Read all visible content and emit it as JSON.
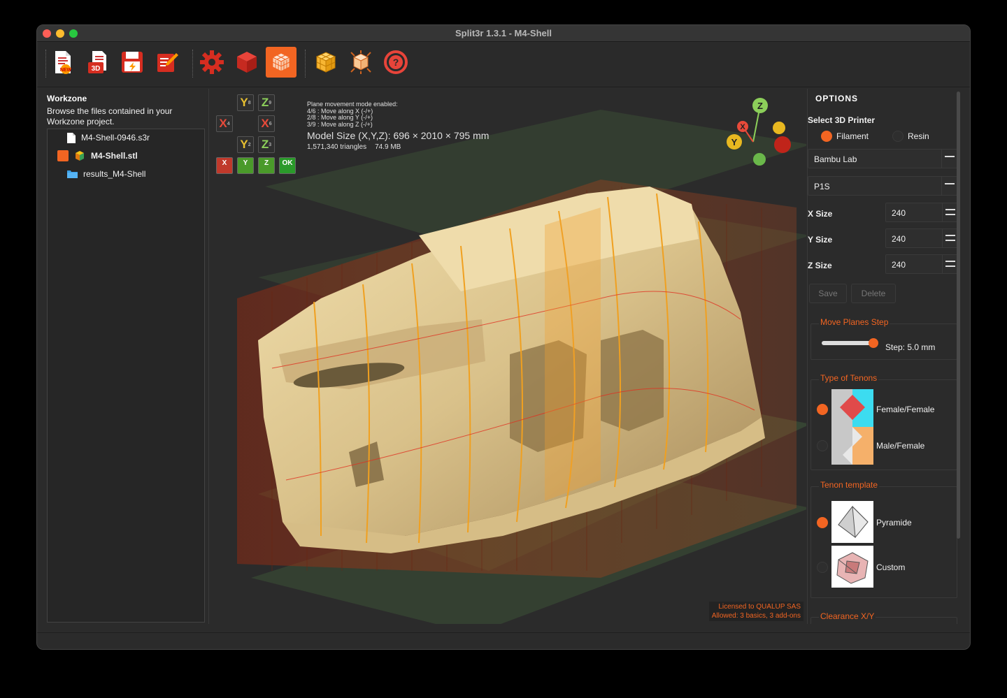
{
  "window": {
    "title": "Split3r 1.3.1 - M4-Shell"
  },
  "toolbar": {
    "buttons": [
      {
        "name": "new-project",
        "icon": "new-file-icon"
      },
      {
        "name": "open-3d",
        "icon": "open-3d-icon",
        "badge": "3D"
      },
      {
        "name": "save",
        "icon": "save-icon"
      },
      {
        "name": "edit",
        "icon": "edit-icon"
      },
      {
        "name": "settings",
        "icon": "gear-icon"
      },
      {
        "name": "view-model",
        "icon": "red-cube-icon"
      },
      {
        "name": "split-planes",
        "icon": "grid-cube-icon",
        "active": true
      },
      {
        "name": "split-result",
        "icon": "split-cube-icon"
      },
      {
        "name": "explode",
        "icon": "explode-cube-icon"
      },
      {
        "name": "help",
        "icon": "help-icon"
      }
    ]
  },
  "workzone": {
    "title": "Workzone",
    "description": "Browse the files contained in your Workzone project.",
    "files": [
      {
        "name": "M4-Shell-0946.s3r",
        "icon": "document-icon"
      },
      {
        "name": "M4-Shell.stl",
        "icon": "cube-icon"
      },
      {
        "name": "results_M4-Shell",
        "icon": "folder-icon"
      }
    ]
  },
  "viewport": {
    "axis_buttons": {
      "y_plus": "Y",
      "y_plus_sub": "8",
      "z_plus": "Z",
      "z_plus_sub": "9",
      "x_minus": "X",
      "x_minus_sub": "4",
      "x_plus": "X",
      "x_plus_sub": "6",
      "y_minus": "Y",
      "y_minus_sub": "2",
      "z_minus": "Z",
      "z_minus_sub": "3"
    },
    "action_buttons": [
      "X",
      "Y",
      "Z",
      "OK"
    ],
    "info": {
      "mode": "Plane movement mode enabled:",
      "line1": "4/6 : Move along X (-/+)",
      "line2": "2/8 : Move along Y (-/+)",
      "line3": "3/9 : Move along Z (-/+)",
      "model_size": "Model Size (X,Y,Z): 696 × 2010 × 795 mm",
      "triangles": "1,571,340 triangles",
      "file_size": "74.9 MB"
    },
    "gizmo": {
      "z": "Z",
      "x": "X",
      "y": "Y"
    },
    "license": {
      "line1": "Licensed to QUALUP SAS",
      "line2": "Allowed: 3 basics, 3 add-ons"
    }
  },
  "options": {
    "title": "OPTIONS",
    "printer_label": "Select 3D Printer",
    "printer_types": [
      {
        "label": "Filament",
        "selected": true
      },
      {
        "label": "Resin",
        "selected": false
      }
    ],
    "brand": "Bambu Lab",
    "model": "P1S",
    "x_size_label": "X Size",
    "x_size": "240",
    "y_size_label": "Y Size",
    "y_size": "240",
    "z_size_label": "Z Size",
    "z_size": "240",
    "save_label": "Save",
    "delete_label": "Delete",
    "move_step": {
      "title": "Move Planes Step",
      "value": 0.95,
      "label": "Step: 5.0 mm"
    },
    "tenons": {
      "title": "Type of Tenons",
      "options": [
        {
          "label": "Female/Female",
          "selected": true
        },
        {
          "label": "Male/Female",
          "selected": false
        }
      ]
    },
    "template": {
      "title": "Tenon template",
      "options": [
        {
          "label": "Pyramide",
          "selected": true
        },
        {
          "label": "Custom",
          "selected": false
        }
      ]
    },
    "clearance_title": "Clearance X/Y"
  },
  "colors": {
    "accent": "#f26522",
    "bg": "#2b2b2b"
  }
}
